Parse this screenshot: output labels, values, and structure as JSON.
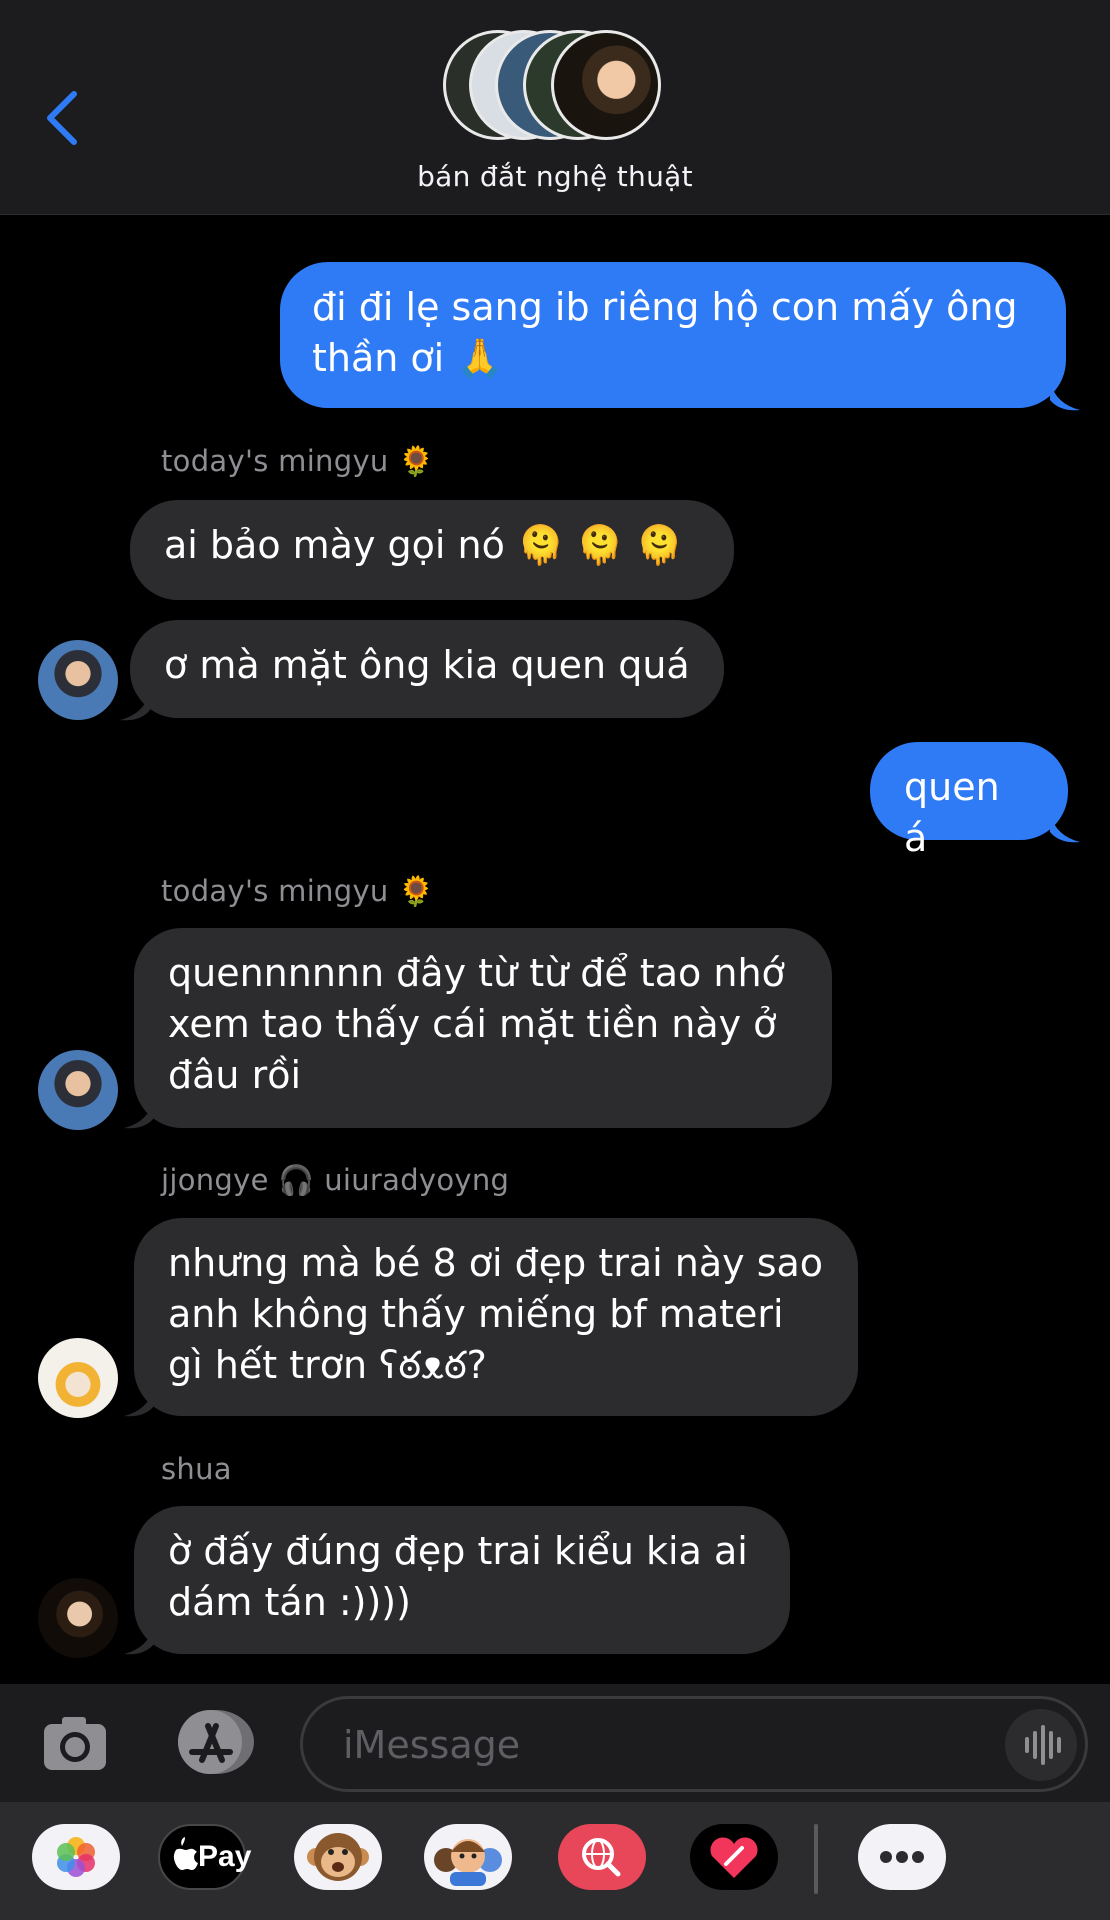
{
  "header": {
    "back_icon": "chevron-left-icon",
    "group_name": "bán đắt nghệ thuật"
  },
  "messages": [
    {
      "direction": "out",
      "text": "đi đi lẹ sang ib riêng hộ con mấy ông thần ơi 🙏"
    },
    {
      "direction": "in",
      "sender": "today's mingyu 🌻",
      "text": "ai bảo mày gọi nó 🫠 🫠 🫠"
    },
    {
      "direction": "in",
      "text": "ơ mà mặt ông kia quen quá"
    },
    {
      "direction": "out",
      "text": "quen á"
    },
    {
      "direction": "in",
      "sender": "today's mingyu 🌻",
      "text": "quennnnnn đây từ từ để tao nhớ xem tao thấy cái mặt tiền này ở đâu rồi"
    },
    {
      "direction": "in",
      "sender": "jjongye 🎧 uiuradyoyng",
      "text": "nhưng mà bé 8 ơi đẹp trai này sao anh không thấy miếng bf materi gì hết trơn ʕఠᴥఠ?"
    },
    {
      "direction": "in",
      "sender": "shua",
      "text": "ờ đấy đúng đẹp trai kiểu kia ai dám tán :))))"
    }
  ],
  "input": {
    "placeholder": "iMessage",
    "camera_icon": "camera-icon",
    "apps_icon": "app-store-icon",
    "audio_icon": "waveform-icon"
  },
  "app_strip": {
    "items": [
      "photos-icon",
      "apple-pay-icon",
      "animoji-monkey-icon",
      "memoji-icon",
      "web-search-icon",
      "digital-touch-icon",
      "more-icon"
    ],
    "pay_label": "Pay"
  }
}
